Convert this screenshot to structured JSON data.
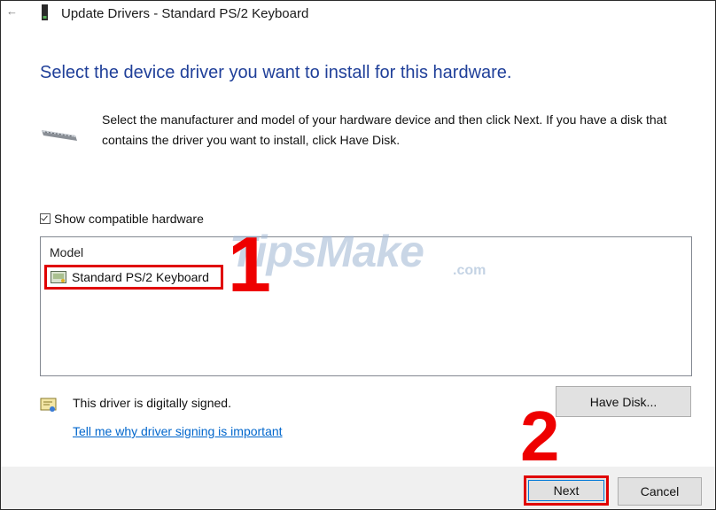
{
  "window": {
    "title": "Update Drivers - Standard PS/2 Keyboard",
    "back_icon": "back-arrow-icon",
    "title_icon": "device-icon"
  },
  "heading": "Select the device driver you want to install for this hardware.",
  "description": "Select the manufacturer and model of your hardware device and then click Next. If you have a disk that contains the driver you want to install, click Have Disk.",
  "show_compatible": {
    "label": "Show compatible hardware",
    "checked": true
  },
  "model_list": {
    "header": "Model",
    "items": [
      {
        "label": "Standard PS/2 Keyboard",
        "icon": "driver-icon",
        "selected": true
      }
    ]
  },
  "watermark": {
    "text": "TipsMake",
    "suffix": ".com"
  },
  "annotations": {
    "step1": "1",
    "step2": "2",
    "color": "#ee0000"
  },
  "signature": {
    "text": "This driver is digitally signed.",
    "link": "Tell me why driver signing is important"
  },
  "buttons": {
    "have_disk": "Have Disk...",
    "next": "Next",
    "cancel": "Cancel"
  },
  "colors": {
    "heading": "#1f3f99",
    "link": "#0066cc",
    "highlight": "#e00000"
  }
}
